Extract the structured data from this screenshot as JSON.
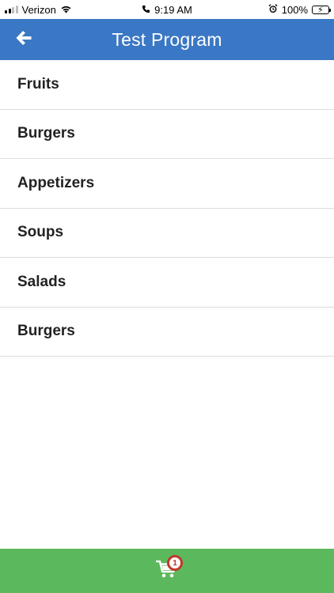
{
  "status_bar": {
    "carrier": "Verizon",
    "time": "9:19 AM",
    "battery": "100%"
  },
  "header": {
    "title": "Test Program",
    "back_icon": "arrow-left-icon",
    "color": "#3a77c4"
  },
  "categories": [
    {
      "label": "Fruits"
    },
    {
      "label": "Burgers"
    },
    {
      "label": "Appetizers"
    },
    {
      "label": "Soups"
    },
    {
      "label": "Salads"
    },
    {
      "label": "Burgers"
    }
  ],
  "footer": {
    "cart_icon": "shopping-cart-icon",
    "cart_count": "1",
    "color": "#5cb85c",
    "badge_color": "#c0392b"
  }
}
